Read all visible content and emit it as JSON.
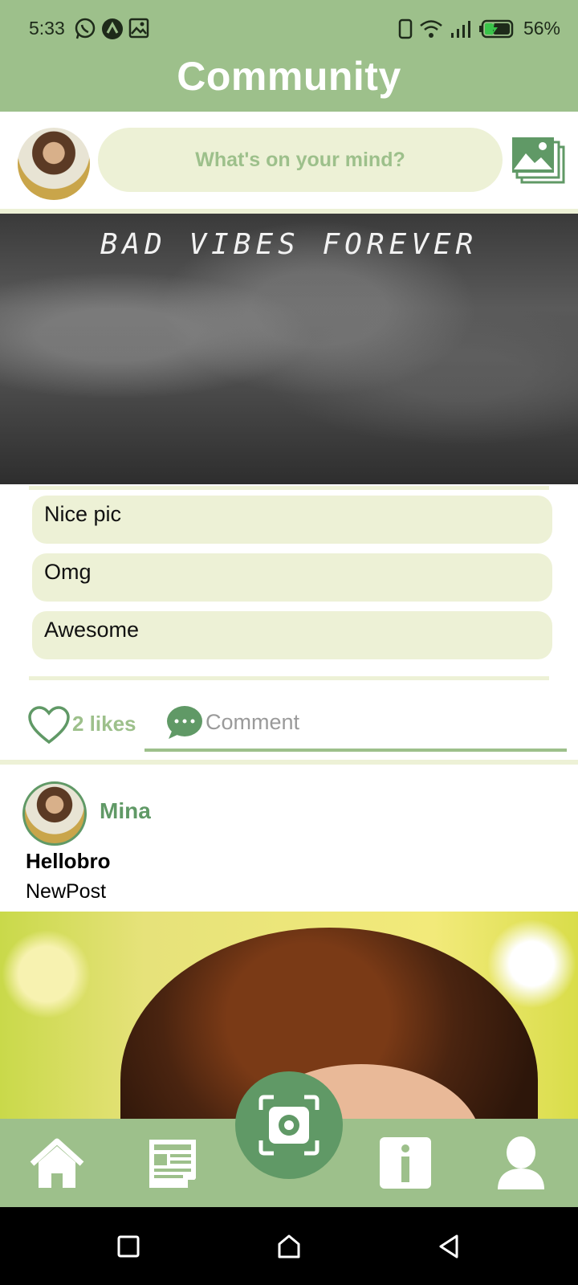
{
  "status_bar": {
    "time": "5:33",
    "battery": "56%",
    "icons": [
      "whatsapp-icon",
      "app-notification-icon",
      "gallery-notification-icon",
      "phone-icon",
      "wifi-icon",
      "signal-icon",
      "battery-charging-icon"
    ]
  },
  "header": {
    "title": "Community"
  },
  "composer": {
    "placeholder": "What's on your mind?",
    "icons": [
      "user-avatar",
      "gallery-icon"
    ]
  },
  "post1": {
    "image_text": "BAD VIBES FOREVER",
    "comments": [
      "Nice pic",
      "Omg",
      "Awesome"
    ],
    "likes_label": "2 likes",
    "comment_label": "Comment"
  },
  "post2": {
    "author": "Mina",
    "title": "Hellobro",
    "text": "NewPost"
  },
  "bottom_nav": {
    "items": [
      "home-icon",
      "news-icon",
      "camera-icon",
      "info-icon",
      "profile-icon"
    ]
  },
  "system_nav": {
    "items": [
      "recents-icon",
      "home-icon",
      "back-icon"
    ]
  },
  "colors": {
    "primary": "#9dc08b",
    "primary_dark": "#609966",
    "light": "#edf1d6"
  }
}
